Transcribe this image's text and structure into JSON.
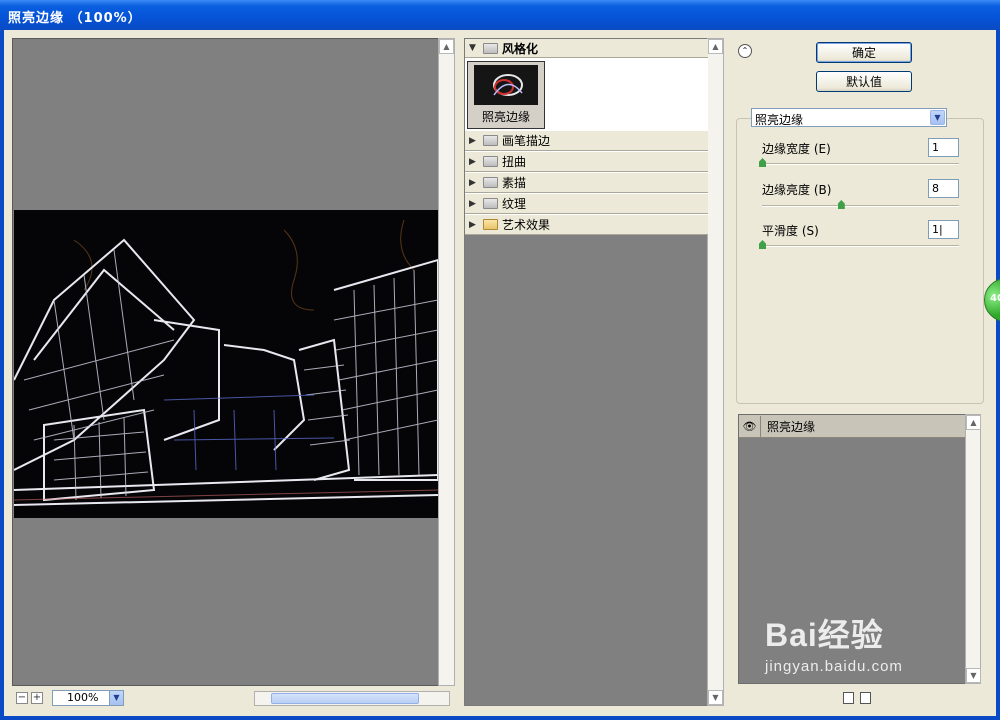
{
  "window": {
    "title": "照亮边缘 （100%）"
  },
  "preview": {
    "zoom": "100%",
    "zoom_out_label": "−",
    "zoom_in_label": "+"
  },
  "gallery": {
    "open_category": "风格化",
    "selected_filter": "照亮边缘",
    "categories": [
      {
        "label": "画笔描边"
      },
      {
        "label": "扭曲"
      },
      {
        "label": "素描"
      },
      {
        "label": "纹理"
      },
      {
        "label": "艺术效果"
      }
    ]
  },
  "actions": {
    "ok_label": "确定",
    "default_label": "默认值"
  },
  "settings": {
    "filter_select": "照亮边缘",
    "params": [
      {
        "label": "边缘宽度 (E)",
        "value": "1",
        "level": 0.0
      },
      {
        "label": "边缘亮度 (B)",
        "value": "8",
        "level": 0.4
      },
      {
        "label": "平滑度 (S)",
        "value": "1|",
        "level": 0.0
      }
    ]
  },
  "layers": {
    "items": [
      {
        "label": "照亮边缘"
      }
    ]
  },
  "side_badge": "40",
  "watermark": {
    "main": "Bai经验",
    "sub": "jingyan.baidu.com"
  },
  "colors": {
    "title_bar": "#0553d6",
    "panel_bg": "#ece9d8",
    "gray_area": "#808080",
    "slider": "#3fa048"
  }
}
